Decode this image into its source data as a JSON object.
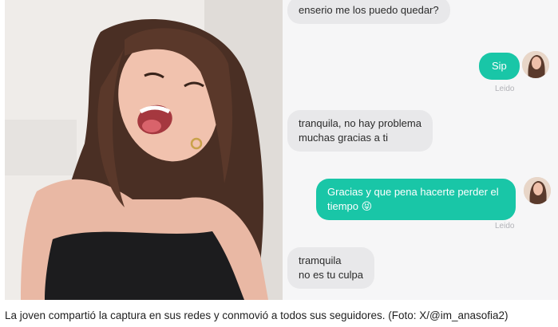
{
  "messages": [
    {
      "text": "enserio me los puedo quedar?"
    },
    {
      "text": "Sip",
      "status": "Leido"
    },
    {
      "text": "tranquila, no hay problema\nmuchas gracias a ti"
    },
    {
      "text": "Gracias y que pena hacerte perder el\ntiempo 😝",
      "status": "Leido"
    },
    {
      "text": "tramquila\nno es tu culpa"
    }
  ],
  "caption": "La joven compartió la captura en sus redes y conmovió a todos sus seguidores. (Foto: X/@im_anasofia2)",
  "colors": {
    "sent_bubble": "#19c6a7",
    "received_bubble": "#e8e8ea",
    "chat_background": "#f6f6f7",
    "read_status": "#b3b3b8"
  }
}
